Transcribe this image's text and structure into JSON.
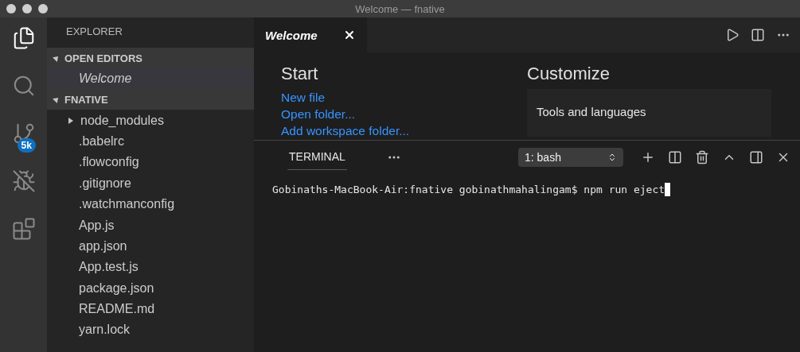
{
  "window": {
    "title": "Welcome — fnative"
  },
  "activity_bar": [
    {
      "kind": "files",
      "selected": true
    },
    {
      "kind": "search",
      "selected": false
    },
    {
      "kind": "source_control",
      "selected": false,
      "badge": "5k"
    },
    {
      "kind": "debug",
      "selected": false
    },
    {
      "kind": "extensions",
      "selected": false
    }
  ],
  "sidebar": {
    "title": "EXPLORER",
    "sections": [
      {
        "title": "OPEN EDITORS",
        "expanded": true,
        "items": [
          {
            "label": "Welcome",
            "kind": "editor",
            "selected": true
          }
        ]
      },
      {
        "title": "FNATIVE",
        "expanded": true,
        "items": [
          {
            "label": "node_modules",
            "kind": "folder",
            "expanded": false,
            "selected": false
          },
          {
            "label": ".babelrc",
            "kind": "file",
            "selected": false
          },
          {
            "label": ".flowconfig",
            "kind": "file",
            "selected": false
          },
          {
            "label": ".gitignore",
            "kind": "file",
            "selected": false
          },
          {
            "label": ".watchmanconfig",
            "kind": "file",
            "selected": false
          },
          {
            "label": "App.js",
            "kind": "file",
            "selected": false
          },
          {
            "label": "app.json",
            "kind": "file",
            "selected": false
          },
          {
            "label": "App.test.js",
            "kind": "file",
            "selected": false
          },
          {
            "label": "package.json",
            "kind": "file",
            "selected": false
          },
          {
            "label": "README.md",
            "kind": "file",
            "selected": false
          },
          {
            "label": "yarn.lock",
            "kind": "file",
            "selected": false
          }
        ]
      }
    ]
  },
  "tabs": [
    {
      "label": "Welcome",
      "selected": true
    }
  ],
  "editor_actions": [
    {
      "kind": "run"
    },
    {
      "kind": "split"
    },
    {
      "kind": "more"
    }
  ],
  "welcome": {
    "start_title": "Start",
    "links": [
      "New file",
      "Open folder...",
      "Add workspace folder..."
    ],
    "customize_title": "Customize",
    "card_title": "Tools and languages"
  },
  "panel": {
    "tabs": [
      {
        "label": "TERMINAL",
        "selected": true
      }
    ],
    "terminal_select": "1: bash",
    "actions": [
      {
        "kind": "add"
      },
      {
        "kind": "split"
      },
      {
        "kind": "trash"
      },
      {
        "kind": "maximize"
      },
      {
        "kind": "layout"
      },
      {
        "kind": "close"
      }
    ],
    "terminal_line": "Gobinaths-MacBook-Air:fnative gobinathmahalingam$ npm run eject"
  }
}
